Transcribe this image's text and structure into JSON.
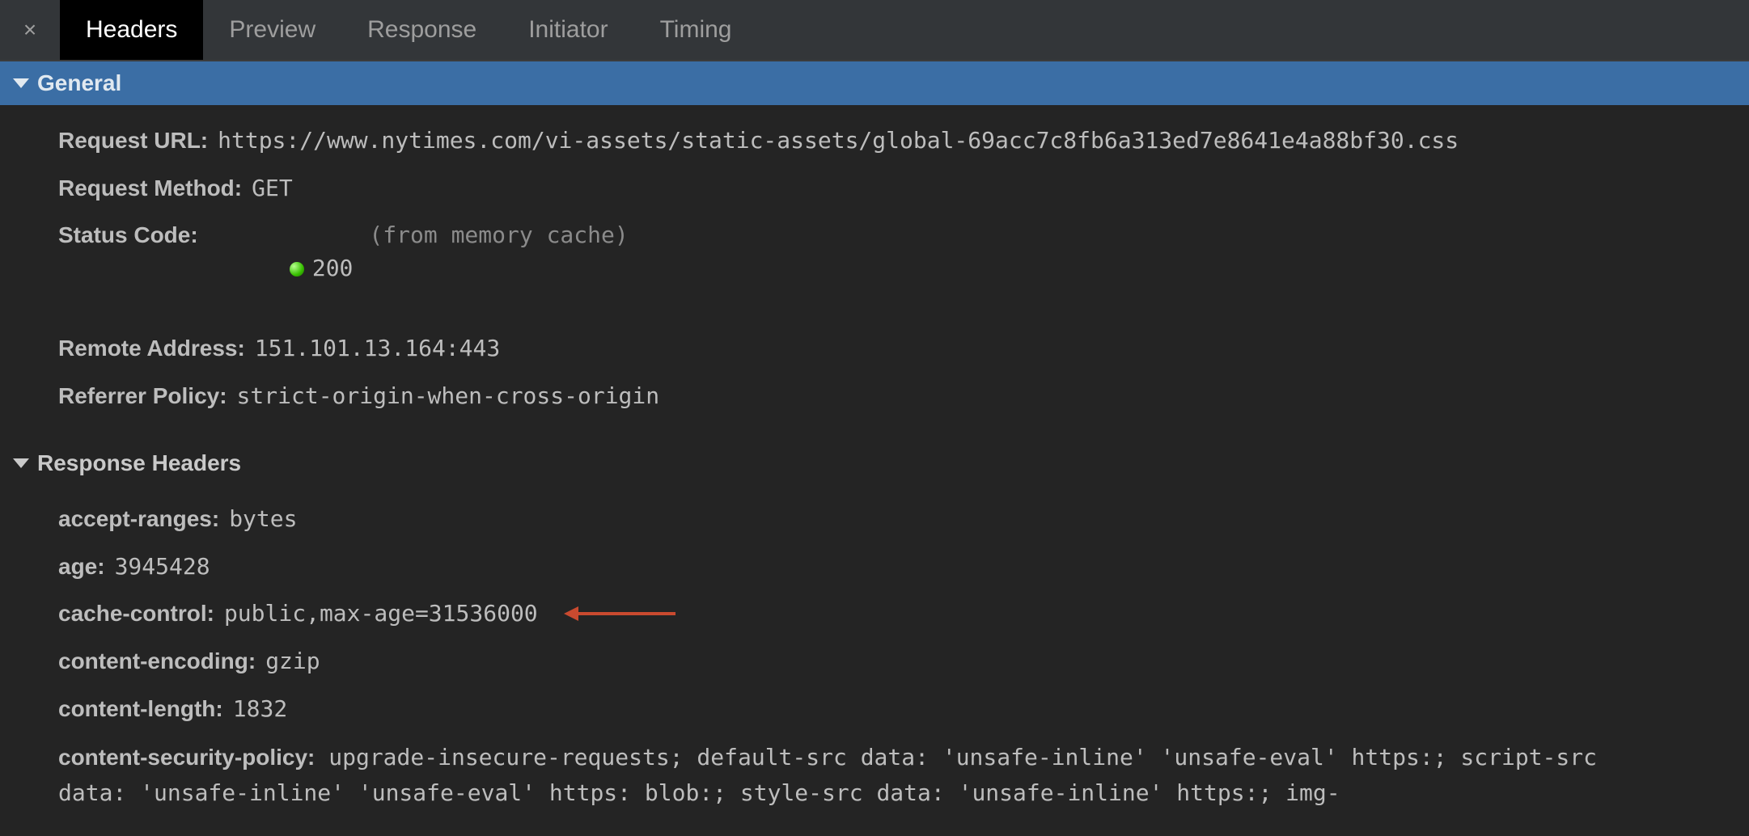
{
  "tabs": {
    "items": [
      {
        "label": "Headers",
        "active": true
      },
      {
        "label": "Preview",
        "active": false
      },
      {
        "label": "Response",
        "active": false
      },
      {
        "label": "Initiator",
        "active": false
      },
      {
        "label": "Timing",
        "active": false
      }
    ]
  },
  "sections": {
    "general": {
      "title": "General",
      "rows": [
        {
          "label": "Request URL:",
          "value": "https://www.nytimes.com/vi-assets/static-assets/global-69acc7c8fb6a313ed7e8641e4a88bf30.css"
        },
        {
          "label": "Request Method:",
          "value": "GET"
        },
        {
          "label": "Status Code:",
          "value": "200",
          "annotation": "(from memory cache)",
          "status_dot": true
        },
        {
          "label": "Remote Address:",
          "value": "151.101.13.164:443"
        },
        {
          "label": "Referrer Policy:",
          "value": "strict-origin-when-cross-origin"
        }
      ]
    },
    "response_headers": {
      "title": "Response Headers",
      "rows": [
        {
          "label": "accept-ranges:",
          "value": "bytes"
        },
        {
          "label": "age:",
          "value": "3945428"
        },
        {
          "label": "cache-control:",
          "value": "public,max-age=31536000",
          "arrow": true
        },
        {
          "label": "content-encoding:",
          "value": "gzip"
        },
        {
          "label": "content-length:",
          "value": "1832"
        }
      ],
      "csp": {
        "label": "content-security-policy:",
        "value": "upgrade-insecure-requests; default-src data: 'unsafe-inline' 'unsafe-eval' https:; script-src data: 'unsafe-inline' 'unsafe-eval' https: blob:; style-src data: 'unsafe-inline' https:; img-"
      }
    }
  }
}
